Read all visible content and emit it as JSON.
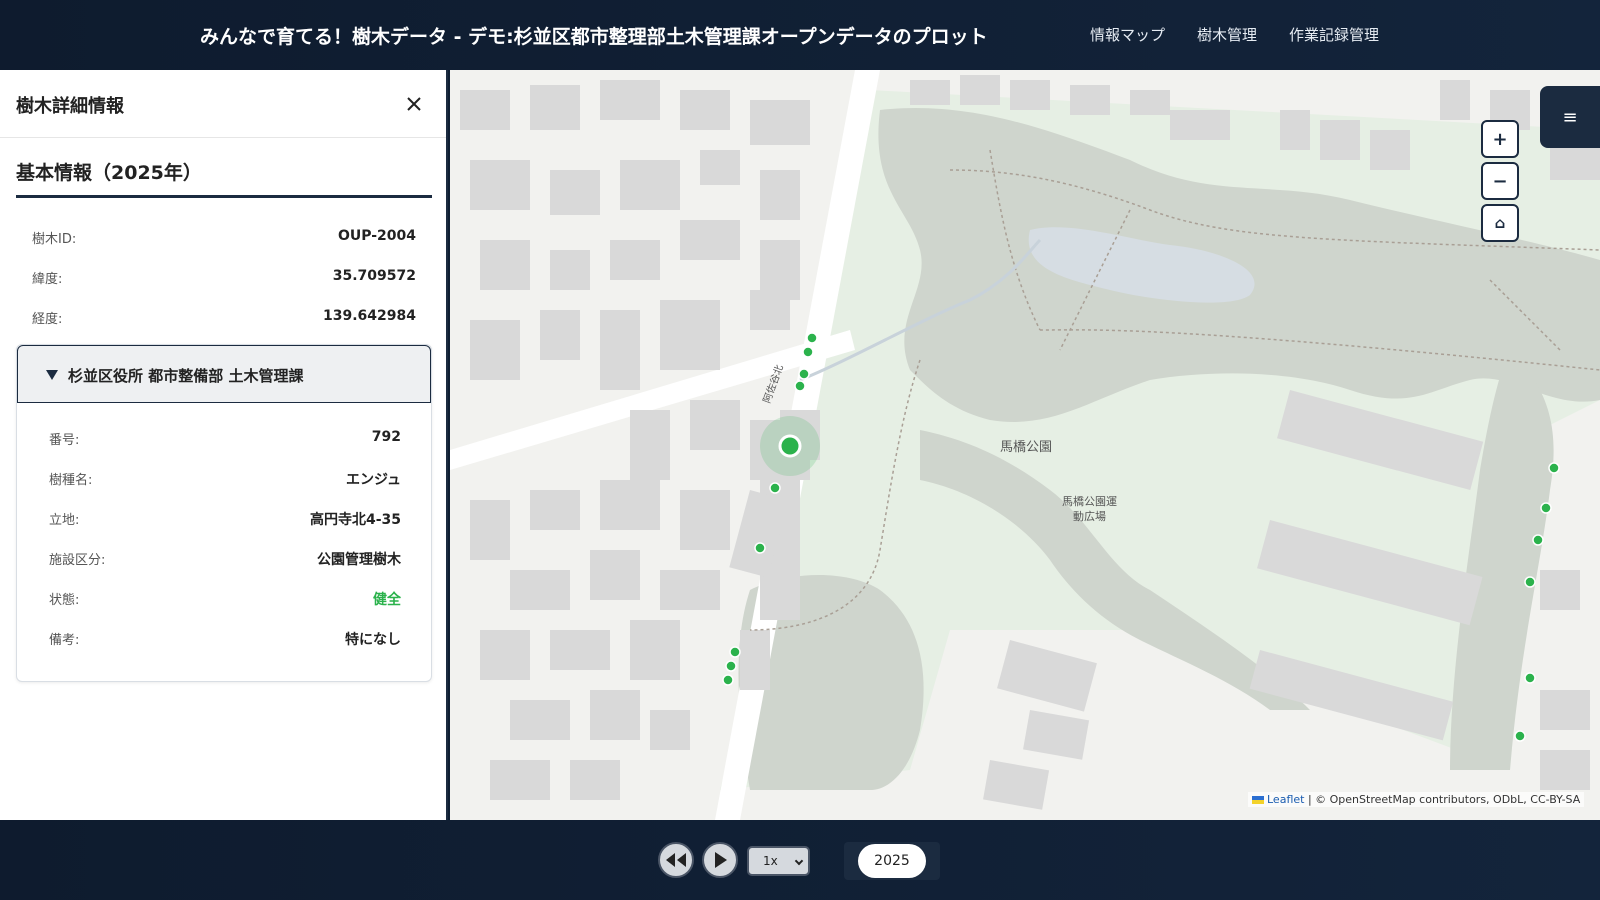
{
  "header": {
    "title": "みんなで育てる！樹木データ - デモ:杉並区都市整理部土木管理課オープンデータのプロット",
    "nav": [
      "情報マップ",
      "樹木管理",
      "作業記録管理"
    ]
  },
  "panel": {
    "title": "樹木詳細情報",
    "section_title": "基本情報（2025年）",
    "basic": [
      {
        "label": "樹木ID:",
        "value": "OUP-2004"
      },
      {
        "label": "緯度:",
        "value": "35.709572"
      },
      {
        "label": "経度:",
        "value": "139.642984"
      }
    ],
    "group": {
      "title": "杉並区役所 都市整備部 土木管理課",
      "rows": [
        {
          "label": "番号:",
          "value": "792"
        },
        {
          "label": "樹種名:",
          "value": "エンジュ"
        },
        {
          "label": "立地:",
          "value": "高円寺北4-35"
        },
        {
          "label": "施設区分:",
          "value": "公園管理樹木"
        },
        {
          "label": "状態:",
          "value": "健全"
        },
        {
          "label": "備考:",
          "value": "特になし"
        }
      ]
    }
  },
  "map": {
    "labels": {
      "park": "馬橋公園",
      "field_line1": "馬橋公園運",
      "field_line2": "動広場",
      "road": "阿佐谷北"
    },
    "controls": {
      "zoom_in": "+",
      "zoom_out": "−",
      "home": "⌂",
      "layers": "≡"
    },
    "attribution": {
      "leaflet": "Leaflet",
      "rest": " | © OpenStreetMap contributors, ODbL, CC-BY-SA"
    },
    "colors": {
      "tree_marker": "#2bb24c",
      "park": "#e6efe4",
      "woods": "#cfd5cd",
      "building": "#d9d9d9"
    }
  },
  "footer": {
    "speed": "1x",
    "year": "2025"
  }
}
